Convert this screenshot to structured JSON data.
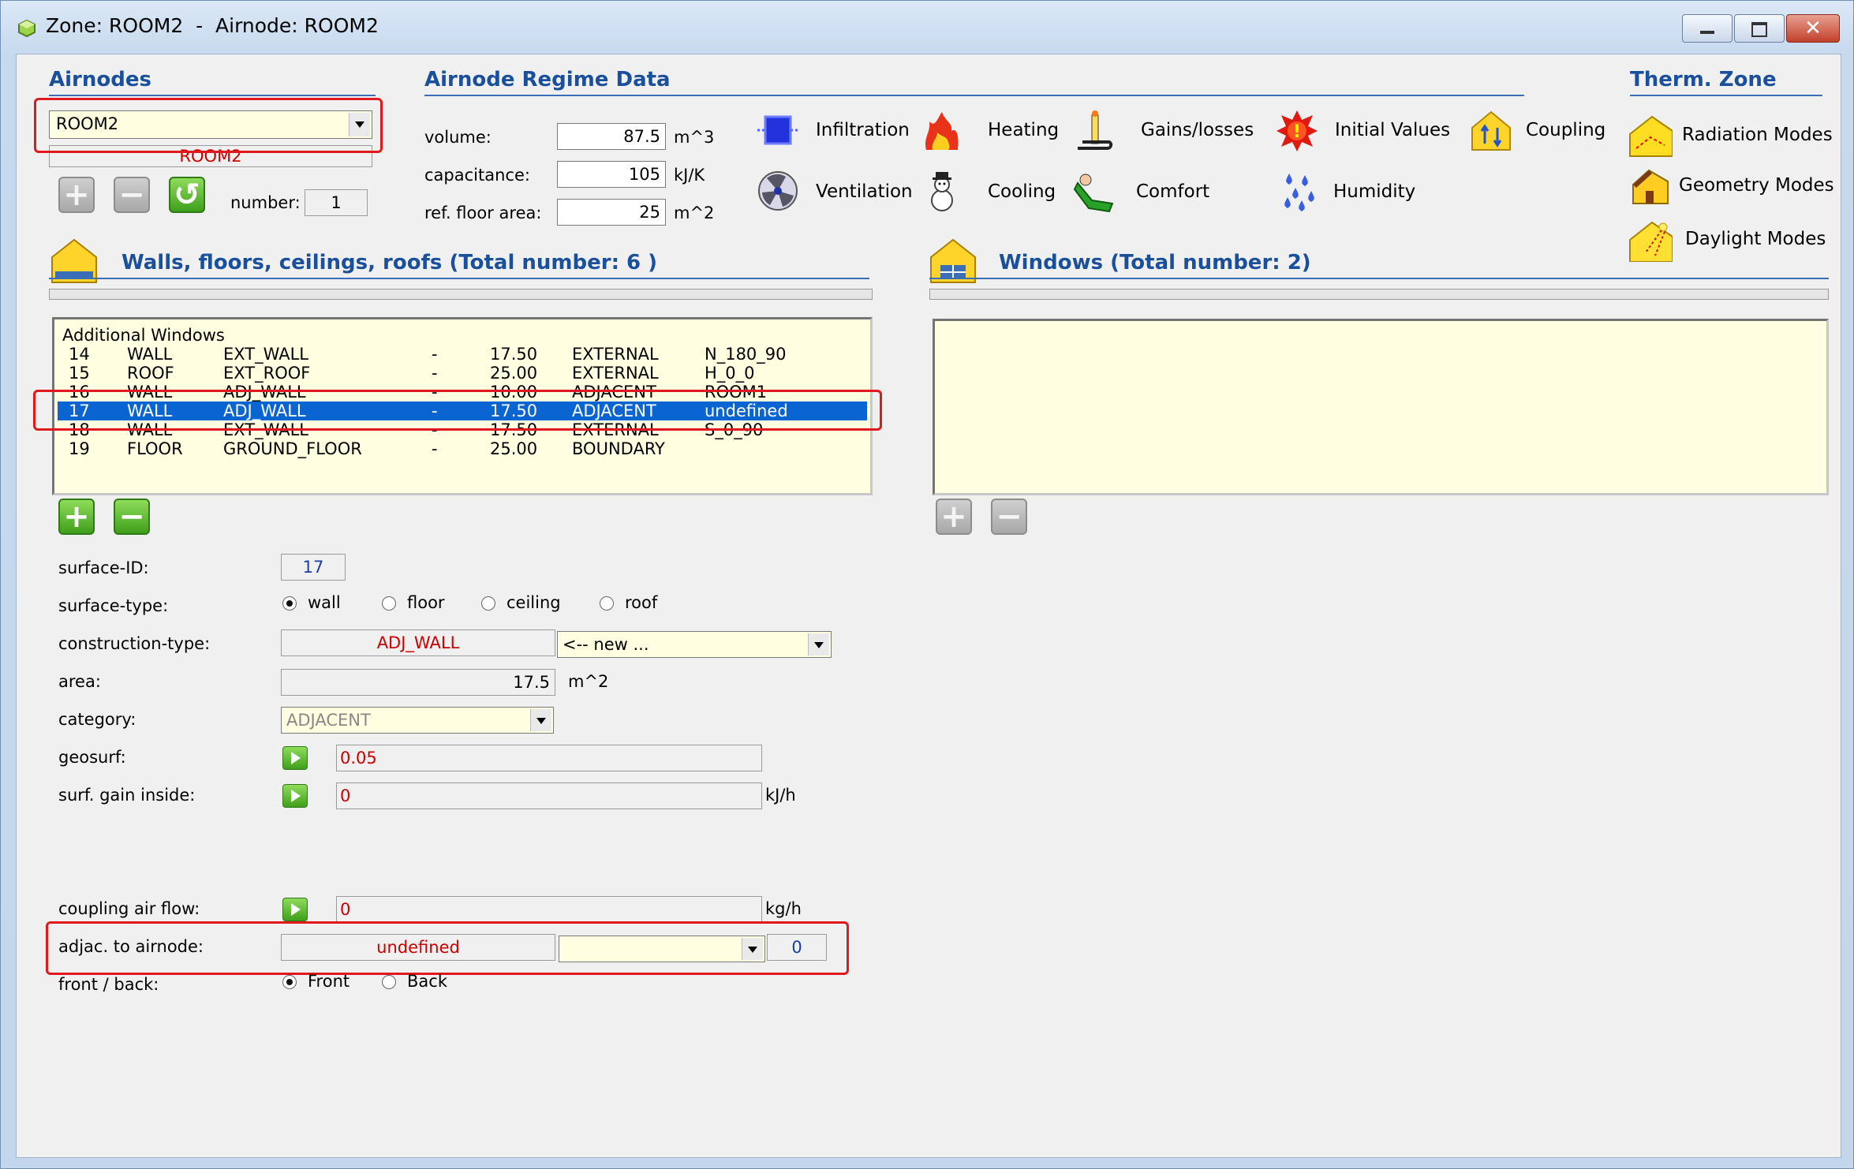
{
  "window": {
    "title": "Zone: ROOM2  -  Airnode: ROOM2"
  },
  "airnodes": {
    "header": "Airnodes",
    "selected": "ROOM2",
    "name_display": "ROOM2",
    "number_label": "number:",
    "number_value": "1"
  },
  "regime": {
    "header": "Airnode Regime Data",
    "volume_label": "volume:",
    "volume_value": "87.5",
    "volume_unit": "m^3",
    "capacitance_label": "capacitance:",
    "capacitance_value": "105",
    "capacitance_unit": "kJ/K",
    "floor_area_label": "ref. floor area:",
    "floor_area_value": "25",
    "floor_area_unit": "m^2"
  },
  "modules": [
    {
      "label": "Infiltration",
      "icon": "infiltration-icon"
    },
    {
      "label": "Heating",
      "icon": "heating-icon"
    },
    {
      "label": "Gains/losses",
      "icon": "gains-losses-icon"
    },
    {
      "label": "Initial Values",
      "icon": "initial-values-icon"
    },
    {
      "label": "Coupling",
      "icon": "coupling-icon"
    },
    {
      "label": "Ventilation",
      "icon": "ventilation-icon"
    },
    {
      "label": "Cooling",
      "icon": "cooling-icon"
    },
    {
      "label": "Comfort",
      "icon": "comfort-icon"
    },
    {
      "label": "Humidity",
      "icon": "humidity-icon"
    }
  ],
  "therm_zone": {
    "header": "Therm. Zone",
    "radiation": "Radiation Modes",
    "geometry": "Geometry Modes",
    "daylight": "Daylight Modes"
  },
  "walls": {
    "header": "Walls, floors, ceilings, roofs (Total number: 6 )",
    "list_header": "Additional Windows",
    "rows": [
      {
        "id": "14",
        "type": "WALL",
        "construction": "EXT_WALL",
        "dash": "-",
        "area": "17.50",
        "category": "EXTERNAL",
        "geo": "N_180_90"
      },
      {
        "id": "15",
        "type": "ROOF",
        "construction": "EXT_ROOF",
        "dash": "-",
        "area": "25.00",
        "category": "EXTERNAL",
        "geo": "H_0_0"
      },
      {
        "id": "16",
        "type": "WALL",
        "construction": "ADJ_WALL",
        "dash": "-",
        "area": "10.00",
        "category": "ADJACENT",
        "geo": "ROOM1"
      },
      {
        "id": "17",
        "type": "WALL",
        "construction": "ADJ_WALL",
        "dash": "-",
        "area": "17.50",
        "category": "ADJACENT",
        "geo": "undefined"
      },
      {
        "id": "18",
        "type": "WALL",
        "construction": "EXT_WALL",
        "dash": "-",
        "area": "17.50",
        "category": "EXTERNAL",
        "geo": "S_0_90"
      },
      {
        "id": "19",
        "type": "FLOOR",
        "construction": "GROUND_FLOOR",
        "dash": "-",
        "area": "25.00",
        "category": "BOUNDARY",
        "geo": ""
      }
    ]
  },
  "windows": {
    "header": "Windows (Total number: 2)"
  },
  "surface": {
    "id_label": "surface-ID:",
    "id_value": "17",
    "type_label": "surface-type:",
    "type_wall": "wall",
    "type_floor": "floor",
    "type_ceiling": "ceiling",
    "type_roof": "roof",
    "construction_label": "construction-type:",
    "construction_value": "ADJ_WALL",
    "construction_combo": "<-- new ...",
    "area_label": "area:",
    "area_value": "17.5",
    "area_unit": "m^2",
    "category_label": "category:",
    "category_value": "ADJACENT",
    "geosurf_label": "geosurf:",
    "geosurf_value": "0.05",
    "gain_label": "surf. gain inside:",
    "gain_value": "0",
    "gain_unit": "kJ/h",
    "coupling_label": "coupling air flow:",
    "coupling_value": "0",
    "coupling_unit": "kg/h",
    "adjac_label": "adjac. to airnode:",
    "adjac_value": "undefined",
    "adjac_number": "0",
    "front_back_label": "front / back:",
    "front": "Front",
    "back": "Back"
  }
}
